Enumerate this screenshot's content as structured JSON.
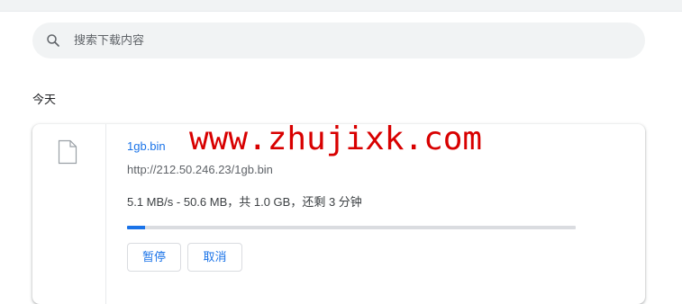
{
  "search": {
    "placeholder": "搜索下载内容",
    "icon": "search-icon"
  },
  "section": {
    "title": "今天"
  },
  "download": {
    "icon": "file-icon",
    "file_name": "1gb.bin",
    "url": "http://212.50.246.23/1gb.bin",
    "status": "5.1 MB/s - 50.6 MB，共 1.0 GB，还剩 3 分钟",
    "progress_fraction": 0.04,
    "pause_label": "暂停",
    "cancel_label": "取消"
  },
  "watermark": {
    "text": "www.zhujixk.com"
  },
  "colors": {
    "accent": "#1a73e8",
    "watermark": "#d80000",
    "search_bg": "#f1f3f4"
  }
}
